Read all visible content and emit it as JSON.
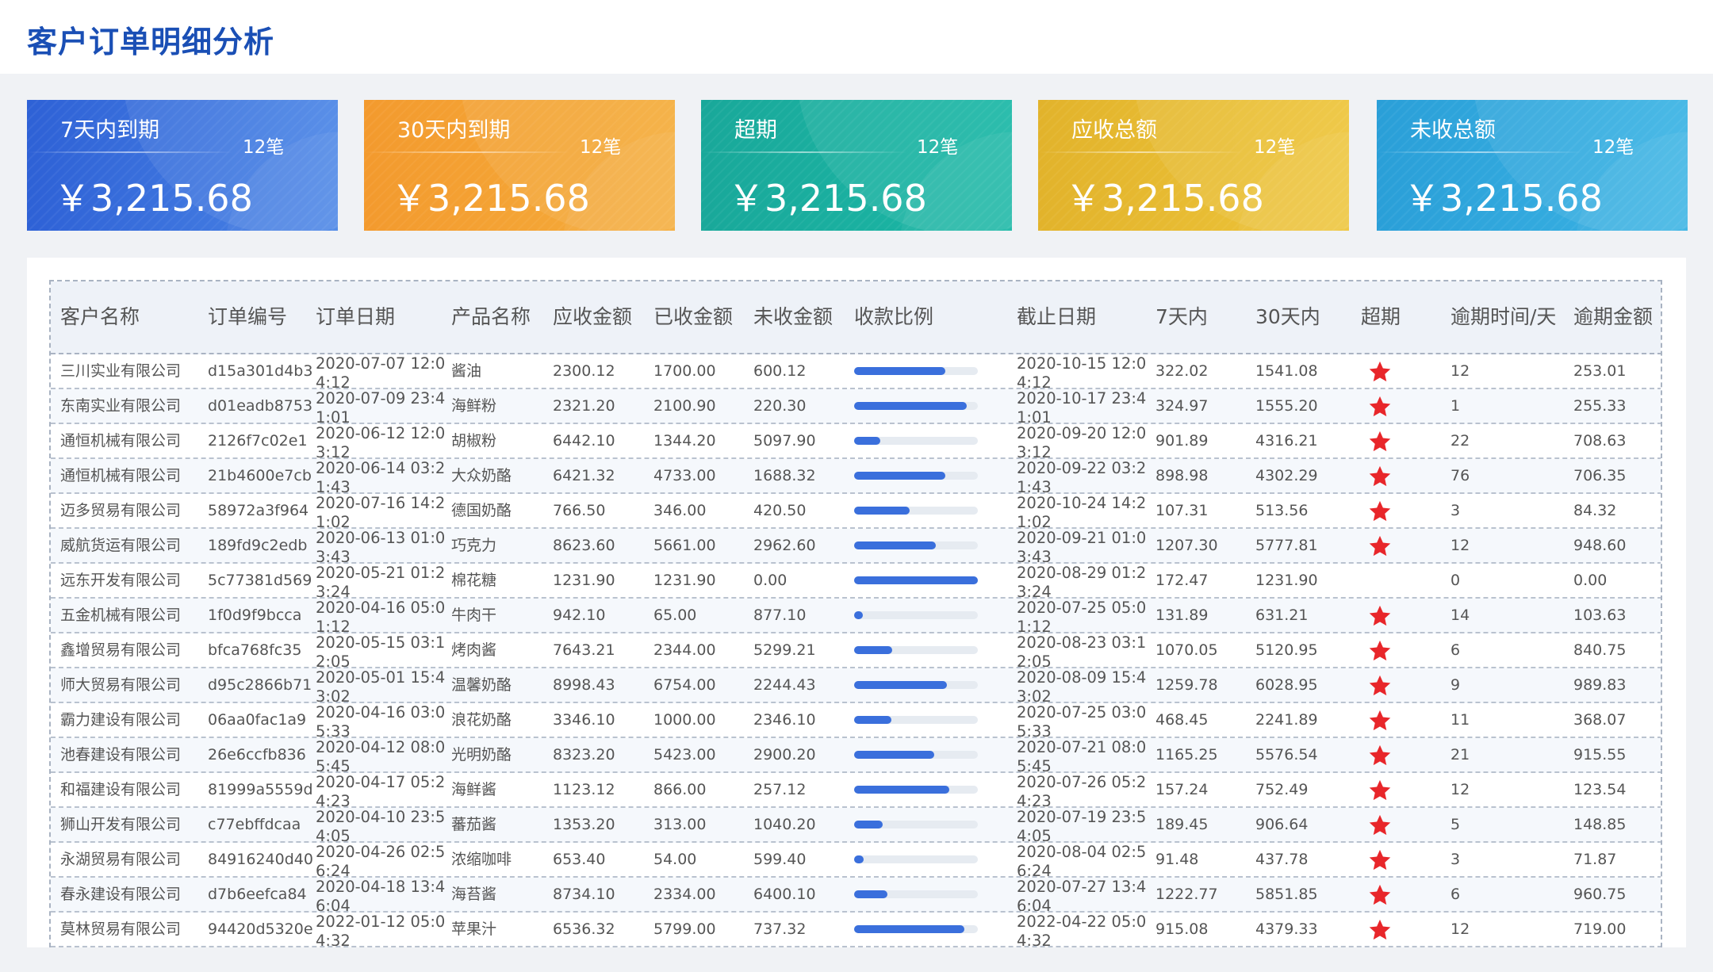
{
  "title": "客户订单明细分析",
  "cards": [
    {
      "title": "7天内到期",
      "count": "12笔",
      "value": "￥3,215.68",
      "color_from": "#2e61d6",
      "color_to": "#4b86e6"
    },
    {
      "title": "30天内到期",
      "count": "12笔",
      "value": "￥3,215.68",
      "color_from": "#f39a2e",
      "color_to": "#f5ad3b"
    },
    {
      "title": "超期",
      "count": "12笔",
      "value": "￥3,215.68",
      "color_from": "#19a89a",
      "color_to": "#1bb8a6"
    },
    {
      "title": "应收总额",
      "count": "12笔",
      "value": "￥3,215.68",
      "color_from": "#e2b32b",
      "color_to": "#eec53a"
    },
    {
      "title": "未收总额",
      "count": "12笔",
      "value": "￥3,215.68",
      "color_from": "#2a9fd8",
      "color_to": "#3ab3e4"
    }
  ],
  "table": {
    "columns": [
      "客户名称",
      "订单编号",
      "订单日期",
      "产品名称",
      "应收金额",
      "已收金额",
      "未收金额",
      "收款比例",
      "截止日期",
      "7天内",
      "30天内",
      "超期",
      "逾期时间/天",
      "逾期金额"
    ],
    "rows": [
      {
        "customer": "三川实业有限公司",
        "order_no": "d15a301d4b3",
        "order_date": "2020-07-07 12:04:12",
        "product": "酱油",
        "receivable": "2300.12",
        "received": "1700.00",
        "unreceived": "600.12",
        "ratio": 0.74,
        "deadline": "2020-10-15 12:04:12",
        "d7": "322.02",
        "d30": "1541.08",
        "overdue": true,
        "overdue_days": "12",
        "overdue_amount": "253.01"
      },
      {
        "customer": "东南实业有限公司",
        "order_no": "d01eadb8753",
        "order_date": "2020-07-09 23:41:01",
        "product": "海鲜粉",
        "receivable": "2321.20",
        "received": "2100.90",
        "unreceived": "220.30",
        "ratio": 0.91,
        "deadline": "2020-10-17 23:41:01",
        "d7": "324.97",
        "d30": "1555.20",
        "overdue": true,
        "overdue_days": "1",
        "overdue_amount": "255.33"
      },
      {
        "customer": "通恒机械有限公司",
        "order_no": "2126f7c02e1",
        "order_date": "2020-06-12 12:03:12",
        "product": "胡椒粉",
        "receivable": "6442.10",
        "received": "1344.20",
        "unreceived": "5097.90",
        "ratio": 0.21,
        "deadline": "2020-09-20 12:03:12",
        "d7": "901.89",
        "d30": "4316.21",
        "overdue": true,
        "overdue_days": "22",
        "overdue_amount": "708.63"
      },
      {
        "customer": "通恒机械有限公司",
        "order_no": "21b4600e7cb",
        "order_date": "2020-06-14 03:21:43",
        "product": "大众奶酪",
        "receivable": "6421.32",
        "received": "4733.00",
        "unreceived": "1688.32",
        "ratio": 0.74,
        "deadline": "2020-09-22 03:21:43",
        "d7": "898.98",
        "d30": "4302.29",
        "overdue": true,
        "overdue_days": "76",
        "overdue_amount": "706.35"
      },
      {
        "customer": "迈多贸易有限公司",
        "order_no": "58972a3f964",
        "order_date": "2020-07-16 14:21:02",
        "product": "德国奶酪",
        "receivable": "766.50",
        "received": "346.00",
        "unreceived": "420.50",
        "ratio": 0.45,
        "deadline": "2020-10-24 14:21:02",
        "d7": "107.31",
        "d30": "513.56",
        "overdue": true,
        "overdue_days": "3",
        "overdue_amount": "84.32"
      },
      {
        "customer": "威航货运有限公司",
        "order_no": "189fd9c2edb",
        "order_date": "2020-06-13 01:03:43",
        "product": "巧克力",
        "receivable": "8623.60",
        "received": "5661.00",
        "unreceived": "2962.60",
        "ratio": 0.66,
        "deadline": "2020-09-21 01:03:43",
        "d7": "1207.30",
        "d30": "5777.81",
        "overdue": true,
        "overdue_days": "12",
        "overdue_amount": "948.60"
      },
      {
        "customer": "远东开发有限公司",
        "order_no": "5c77381d569",
        "order_date": "2020-05-21 01:23:24",
        "product": "棉花糖",
        "receivable": "1231.90",
        "received": "1231.90",
        "unreceived": "0.00",
        "ratio": 1.0,
        "deadline": "2020-08-29 01:23:24",
        "d7": "172.47",
        "d30": "1231.90",
        "overdue": false,
        "overdue_days": "0",
        "overdue_amount": "0.00"
      },
      {
        "customer": "五金机械有限公司",
        "order_no": "1f0d9f9bcca",
        "order_date": "2020-04-16 05:01:12",
        "product": "牛肉干",
        "receivable": "942.10",
        "received": "65.00",
        "unreceived": "877.10",
        "ratio": 0.07,
        "deadline": "2020-07-25 05:01:12",
        "d7": "131.89",
        "d30": "631.21",
        "overdue": true,
        "overdue_days": "14",
        "overdue_amount": "103.63"
      },
      {
        "customer": "鑫增贸易有限公司",
        "order_no": "bfca768fc35",
        "order_date": "2020-05-15 03:12:05",
        "product": "烤肉酱",
        "receivable": "7643.21",
        "received": "2344.00",
        "unreceived": "5299.21",
        "ratio": 0.31,
        "deadline": "2020-08-23 03:12:05",
        "d7": "1070.05",
        "d30": "5120.95",
        "overdue": true,
        "overdue_days": "6",
        "overdue_amount": "840.75"
      },
      {
        "customer": "师大贸易有限公司",
        "order_no": "d95c2866b71",
        "order_date": "2020-05-01 15:43:02",
        "product": "温馨奶酪",
        "receivable": "8998.43",
        "received": "6754.00",
        "unreceived": "2244.43",
        "ratio": 0.75,
        "deadline": "2020-08-09 15:43:02",
        "d7": "1259.78",
        "d30": "6028.95",
        "overdue": true,
        "overdue_days": "9",
        "overdue_amount": "989.83"
      },
      {
        "customer": "霸力建设有限公司",
        "order_no": "06aa0fac1a9",
        "order_date": "2020-04-16 03:05:33",
        "product": "浪花奶酪",
        "receivable": "3346.10",
        "received": "1000.00",
        "unreceived": "2346.10",
        "ratio": 0.3,
        "deadline": "2020-07-25 03:05:33",
        "d7": "468.45",
        "d30": "2241.89",
        "overdue": true,
        "overdue_days": "11",
        "overdue_amount": "368.07"
      },
      {
        "customer": "池春建设有限公司",
        "order_no": "26e6ccfb836",
        "order_date": "2020-04-12 08:05:45",
        "product": "光明奶酪",
        "receivable": "8323.20",
        "received": "5423.00",
        "unreceived": "2900.20",
        "ratio": 0.65,
        "deadline": "2020-07-21 08:05:45",
        "d7": "1165.25",
        "d30": "5576.54",
        "overdue": true,
        "overdue_days": "21",
        "overdue_amount": "915.55"
      },
      {
        "customer": "和福建设有限公司",
        "order_no": "81999a5559d",
        "order_date": "2020-04-17 05:24:23",
        "product": "海鲜酱",
        "receivable": "1123.12",
        "received": "866.00",
        "unreceived": "257.12",
        "ratio": 0.77,
        "deadline": "2020-07-26 05:24:23",
        "d7": "157.24",
        "d30": "752.49",
        "overdue": true,
        "overdue_days": "12",
        "overdue_amount": "123.54"
      },
      {
        "customer": "狮山开发有限公司",
        "order_no": "c77ebffdcaa",
        "order_date": "2020-04-10 23:54:05",
        "product": "蕃茄酱",
        "receivable": "1353.20",
        "received": "313.00",
        "unreceived": "1040.20",
        "ratio": 0.23,
        "deadline": "2020-07-19 23:54:05",
        "d7": "189.45",
        "d30": "906.64",
        "overdue": true,
        "overdue_days": "5",
        "overdue_amount": "148.85"
      },
      {
        "customer": "永湖贸易有限公司",
        "order_no": "84916240d40",
        "order_date": "2020-04-26 02:56:24",
        "product": "浓缩咖啡",
        "receivable": "653.40",
        "received": "54.00",
        "unreceived": "599.40",
        "ratio": 0.08,
        "deadline": "2020-08-04 02:56:24",
        "d7": "91.48",
        "d30": "437.78",
        "overdue": true,
        "overdue_days": "3",
        "overdue_amount": "71.87"
      },
      {
        "customer": "春永建设有限公司",
        "order_no": "d7b6eefca84",
        "order_date": "2020-04-18 13:46:04",
        "product": "海苔酱",
        "receivable": "8734.10",
        "received": "2334.00",
        "unreceived": "6400.10",
        "ratio": 0.27,
        "deadline": "2020-07-27 13:46:04",
        "d7": "1222.77",
        "d30": "5851.85",
        "overdue": true,
        "overdue_days": "6",
        "overdue_amount": "960.75"
      },
      {
        "customer": "莫林贸易有限公司",
        "order_no": "94420d5320e",
        "order_date": "2022-01-12 05:04:32",
        "product": "苹果汁",
        "receivable": "6536.32",
        "received": "5799.00",
        "unreceived": "737.32",
        "ratio": 0.89,
        "deadline": "2022-04-22 05:04:32",
        "d7": "915.08",
        "d30": "4379.33",
        "overdue": true,
        "overdue_days": "12",
        "overdue_amount": "719.00"
      }
    ]
  },
  "colors": {
    "accent": "#1a4fb5",
    "bar": "#3a6fdc",
    "star": "#e8262a"
  }
}
